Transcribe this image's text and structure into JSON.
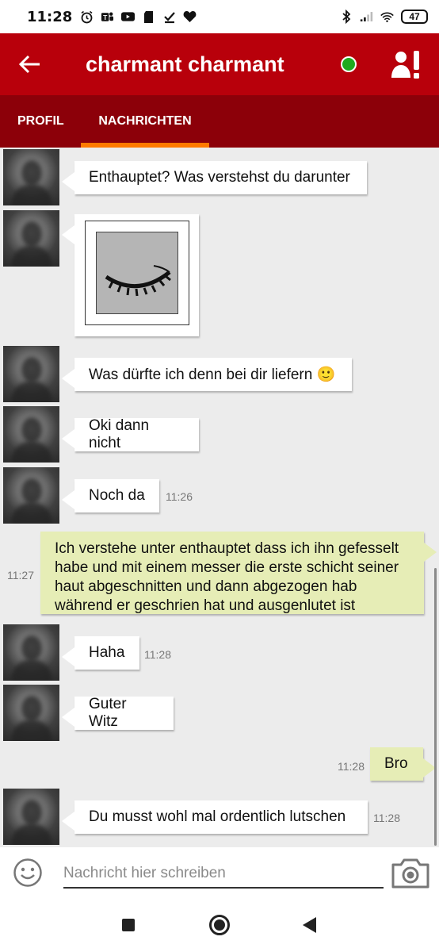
{
  "status_bar": {
    "time": "11:28",
    "battery": "47",
    "left_icons": [
      "alarm-icon",
      "teams-icon",
      "youtube-icon",
      "sdcard-icon",
      "download-done-icon",
      "heart-icon"
    ],
    "right_icons": [
      "bluetooth-icon",
      "signal-icon",
      "wifi-icon"
    ]
  },
  "header": {
    "title": "charmant charmant",
    "online_color": "#1faa1f",
    "brand_color": "#b8000b"
  },
  "tabs": [
    {
      "label": "PROFIL",
      "active": false
    },
    {
      "label": "NACHRICHTEN",
      "active": true
    }
  ],
  "messages": [
    {
      "dir": "in",
      "text": "Enthauptet? Was verstehst du darunter",
      "time": ""
    },
    {
      "dir": "in",
      "type": "image",
      "text": "",
      "time": ""
    },
    {
      "dir": "in",
      "text": "Was dürfte ich denn bei dir liefern 🙂",
      "time": ""
    },
    {
      "dir": "in",
      "text": "Oki dann nicht",
      "time": ""
    },
    {
      "dir": "in",
      "text": "Noch da",
      "time": "11:26"
    },
    {
      "dir": "out",
      "text": "Ich verstehe unter enthauptet dass ich ihn gefesselt habe und mit einem messer die erste schicht seiner haut abgeschnitten und dann abgezogen hab während er geschrien hat und ausgenlutet ist",
      "time": "11:27"
    },
    {
      "dir": "in",
      "text": "Haha",
      "time": "11:28"
    },
    {
      "dir": "in",
      "text": "Guter Witz",
      "time": ""
    },
    {
      "dir": "out",
      "text": "Bro",
      "time": "11:28"
    },
    {
      "dir": "in",
      "text": "Du musst wohl mal ordentlich lutschen",
      "time": "11:28"
    }
  ],
  "composer": {
    "placeholder": "Nachricht hier schreiben"
  }
}
